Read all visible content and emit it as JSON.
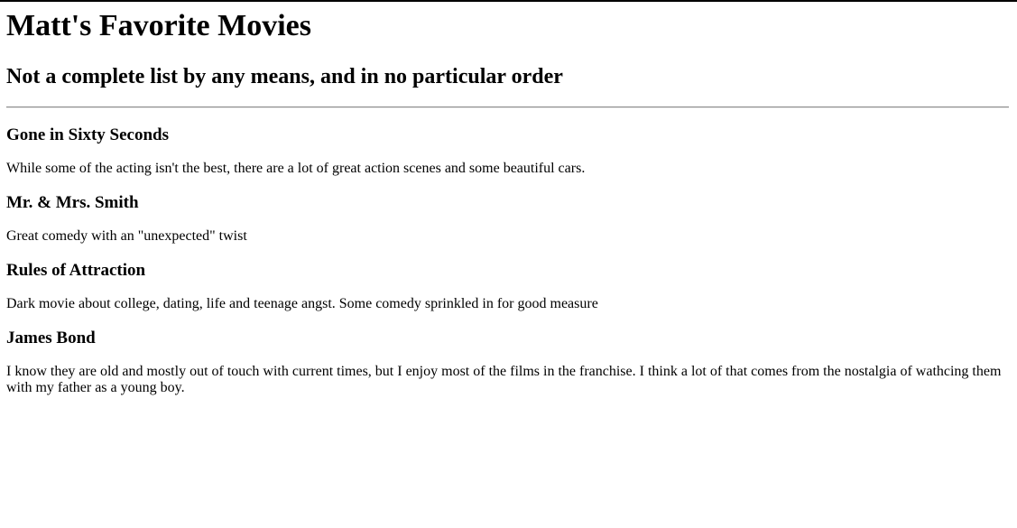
{
  "page": {
    "title": "Matt's Favorite Movies",
    "subtitle": "Not a complete list by any means, and in no particular order"
  },
  "movies": [
    {
      "title": "Gone in Sixty Seconds",
      "description": "While some of the acting isn't the best, there are a lot of great action scenes and some beautiful cars."
    },
    {
      "title": "Mr. & Mrs. Smith",
      "description": "Great comedy with an \"unexpected\" twist"
    },
    {
      "title": "Rules of Attraction",
      "description": "Dark movie about college, dating, life and teenage angst. Some comedy sprinkled in for good measure"
    },
    {
      "title": "James Bond",
      "description": "I know they are old and mostly out of touch with current times, but I enjoy most of the films in the franchise. I think a lot of that comes from the nostalgia of wathcing them with my father as a young boy."
    }
  ]
}
